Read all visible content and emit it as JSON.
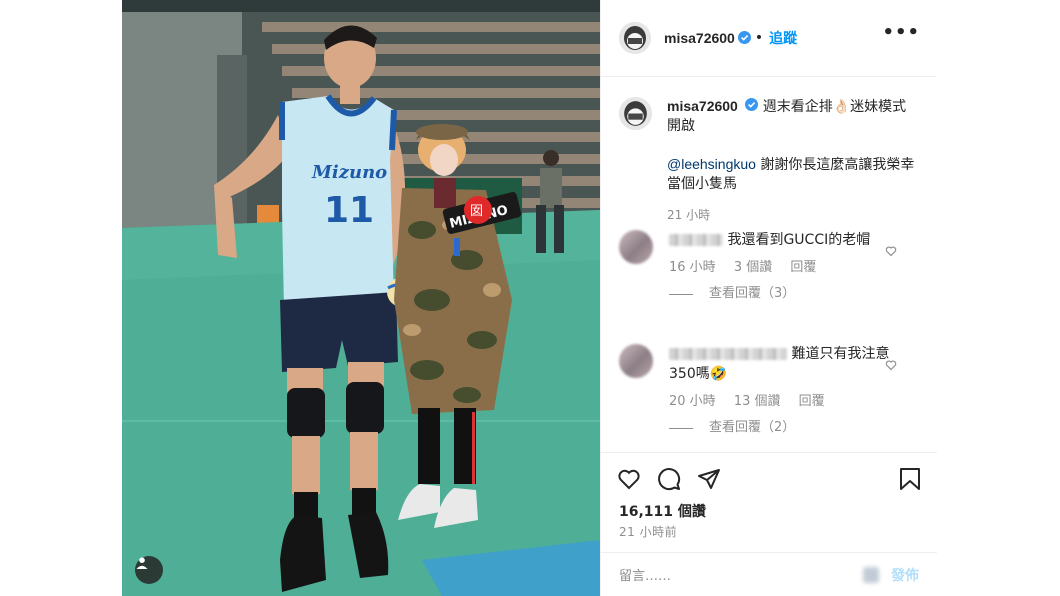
{
  "post": {
    "username": "misa72600",
    "follow_label": "追蹤",
    "separator": "•",
    "more_label": "•••",
    "caption_line1": "週末看企排👌🏻迷妹模式開啟",
    "caption_mention": "@leehsingkuo",
    "caption_line2": " 謝謝你長這麼高讓我榮幸當個小隻馬",
    "caption_time": "21 小時",
    "jersey_brand": "Mizuno",
    "jersey_number": "11",
    "sign_text": "MIZUNO",
    "sign_badge": "囡"
  },
  "comments": [
    {
      "text": "我還看到GUCCI的老帽",
      "time": "16 小時",
      "likes": "3 個讚",
      "reply": "回覆",
      "view_replies": "查看回覆（3）"
    },
    {
      "text": "難道只有我注意350嗎🤣",
      "time": "20 小時",
      "likes": "13 個讚",
      "reply": "回覆",
      "view_replies": "查看回覆（2）"
    }
  ],
  "stats": {
    "likes": "16,111 個讚",
    "posted": "21 小時前"
  },
  "composer": {
    "placeholder": "留言……",
    "post_label": "發佈"
  },
  "icons": [
    "verified-badge-icon",
    "more-options-icon",
    "heart-icon",
    "comment-icon",
    "share-icon",
    "bookmark-icon",
    "user-tag-icon"
  ],
  "colors": {
    "accent": "#0095f6",
    "link": "#00376b",
    "muted": "#8e8e8e",
    "court": "#48a58e"
  }
}
